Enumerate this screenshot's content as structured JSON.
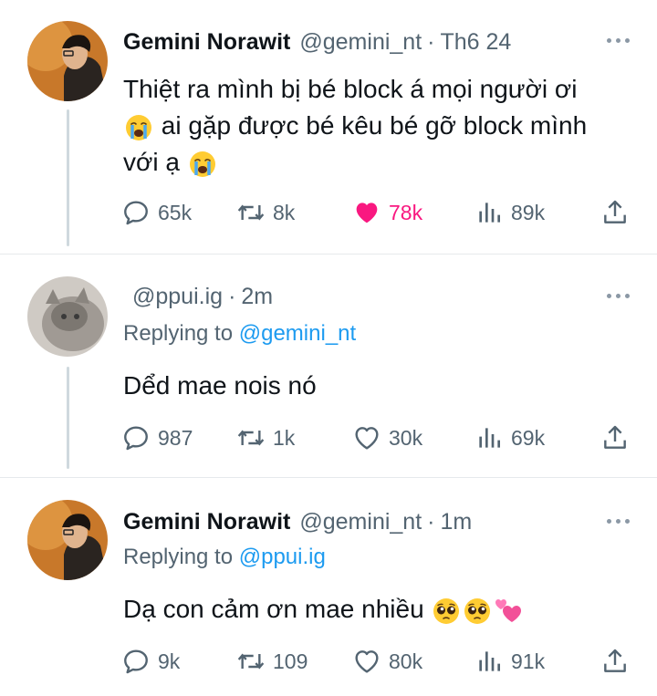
{
  "tweets": [
    {
      "name": "Gemini Norawit",
      "handle": "@gemini_nt",
      "separator": "·",
      "time": "Th6 24",
      "text_line1": "Thiệt ra mình bị bé block á mọi người ơi",
      "text_line2": "ai gặp được bé kêu bé gỡ block mình",
      "text_line3": "với ạ",
      "replies": "65k",
      "retweets": "8k",
      "likes": "78k",
      "views": "89k",
      "liked": true
    },
    {
      "name": "",
      "handle": "@ppui.ig",
      "separator": "·",
      "time": "2m",
      "replying_prefix": "Replying to",
      "replying_to": "@gemini_nt",
      "text": "Dểd mae nois nó",
      "replies": "987",
      "retweets": "1k",
      "likes": "30k",
      "views": "69k",
      "liked": false
    },
    {
      "name": "Gemini Norawit",
      "handle": "@gemini_nt",
      "separator": "·",
      "time": "1m",
      "replying_prefix": "Replying to",
      "replying_to": "@ppui.ig",
      "text": "Dạ con cảm ơn mae nhiều",
      "replies": "9k",
      "retweets": "109",
      "likes": "80k",
      "views": "91k",
      "liked": false
    }
  ],
  "colors": {
    "like": "#f91880",
    "link": "#1d9bf0",
    "muted": "#536471"
  },
  "icons": [
    "reply-icon",
    "retweet-icon",
    "like-icon",
    "views-icon",
    "share-icon",
    "more-icon",
    "loudly-crying-face-emoji",
    "pleading-face-emoji",
    "revolving-hearts-emoji"
  ]
}
